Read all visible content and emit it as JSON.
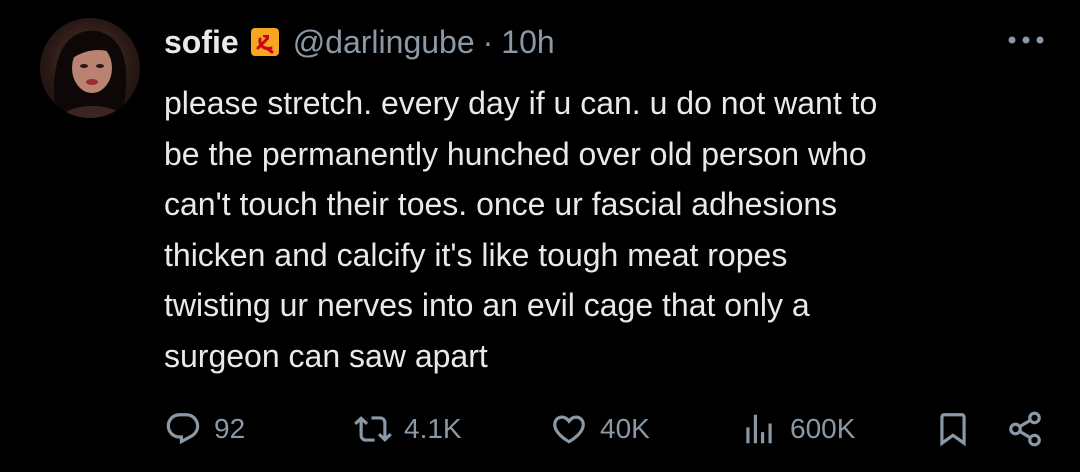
{
  "tweet": {
    "display_name": "sofie",
    "handle": "@darlingube",
    "separator": "·",
    "time": "10h",
    "text": "please stretch. every day if u can. u do not want to\nbe the permanently hunched over old person who\ncan't touch their toes. once ur fascial adhesions\nthicken and calcify it's like tough meat ropes\ntwisting ur nerves into an evil cage that only a\nsurgeon can saw apart"
  },
  "badge": {
    "icon": "hammer-and-sickle-emoji",
    "bg_color": "#f5a623",
    "fg_color": "#d0021b"
  },
  "actions": {
    "reply_count": "92",
    "retweet_count": "4.1K",
    "like_count": "40K",
    "views_count": "600K"
  },
  "icons": {
    "more": "more-dots-icon",
    "reply": "reply-bubble-icon",
    "retweet": "retweet-icon",
    "like": "heart-icon",
    "views": "views-bars-icon",
    "bookmark": "bookmark-icon",
    "share": "share-icon"
  },
  "colors": {
    "background": "#000000",
    "primary_text": "#e7e9ea",
    "secondary_text": "#8b98a5"
  }
}
